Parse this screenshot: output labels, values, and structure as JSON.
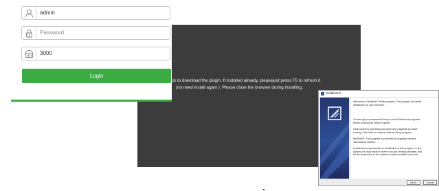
{
  "login": {
    "username_value": "admin",
    "password_placeholder": "Password",
    "port_value": "3000",
    "login_label": "Login"
  },
  "plugin_notice": {
    "line1": "ck to download the plugin. If installed already, pleasejust press F5 to refresh it",
    "line2": "(no need install again ). Please close the browser during installing."
  },
  "setup_dialog": {
    "title": "SeaBirs6.0",
    "para1": "Welcome to SeaBirs6.0 Setup program. This program will install\nSeaBirs6.0 on your computer.",
    "para2": "It is strongly recommended that you exit all Windows programs\nbefore running this Setup Program.",
    "para3": "Click Cancel to quit Setup and close any programs you have\nrunning. Click Next to continue with the Setup program.",
    "para4": "WARNING: This program is protected by copyright law and\ninternational treaties.",
    "para5": "Unauthorized reproduction or distribution of this program, or any\nportion of it, may result in severe civil and criminal penalties, and\nwill be prosecuted to the maximum extent possible under law.",
    "next_label": "Next>",
    "cancel_label": "Cancel"
  },
  "colors": {
    "accent_green": "#3aac43",
    "dark_panel": "#3c3c3c",
    "installer_blue": "#2f4f98"
  },
  "icons": {
    "user": "user-icon",
    "password": "lock-icon",
    "port": "port-icon",
    "installer": "installer-logo-icon"
  }
}
